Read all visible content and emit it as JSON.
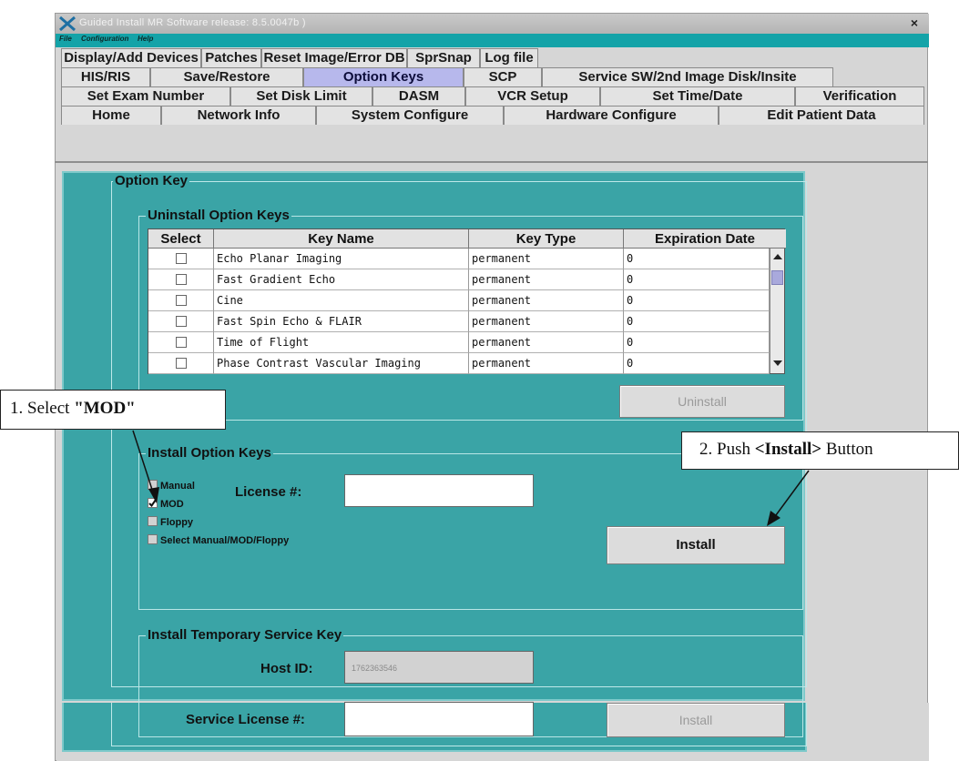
{
  "window": {
    "title": "Guided Install  MR Software release: 8.5.0047b )",
    "close_glyph": "×"
  },
  "menu": {
    "items": [
      "File",
      "Configuration",
      "Help"
    ]
  },
  "tabs": {
    "active": "Option Keys",
    "rows": [
      [
        "Display/Add Devices",
        "Patches",
        "Reset Image/Error DB",
        "SprSnap",
        "Log file"
      ],
      [
        "HIS/RIS",
        "Save/Restore",
        "Option Keys",
        "SCP",
        "Service SW/2nd Image Disk/Insite"
      ],
      [
        "Set Exam Number",
        "Set Disk Limit",
        "DASM",
        "VCR Setup",
        "Set Time/Date",
        "Verification"
      ],
      [
        "Home",
        "Network Info",
        "System Configure",
        "Hardware Configure",
        "Edit Patient Data"
      ]
    ]
  },
  "option_key": {
    "title": "Option Key",
    "uninstall": {
      "title": "Uninstall Option Keys",
      "columns": [
        "Select",
        "Key Name",
        "Key Type",
        "Expiration Date"
      ],
      "rows": [
        {
          "name": "Echo Planar Imaging",
          "type": "permanent",
          "expiration": "0"
        },
        {
          "name": "Fast Gradient Echo",
          "type": "permanent",
          "expiration": "0"
        },
        {
          "name": "Cine",
          "type": "permanent",
          "expiration": "0"
        },
        {
          "name": "Fast Spin Echo & FLAIR",
          "type": "permanent",
          "expiration": "0"
        },
        {
          "name": "Time of Flight",
          "type": "permanent",
          "expiration": "0"
        },
        {
          "name": "Phase Contrast Vascular Imaging",
          "type": "permanent",
          "expiration": "0"
        }
      ],
      "button": "Uninstall"
    },
    "install": {
      "title": "Install Option Keys",
      "options": [
        {
          "label": "Manual",
          "checked": false
        },
        {
          "label": "MOD",
          "checked": true
        },
        {
          "label": "Floppy",
          "checked": false
        },
        {
          "label": "Select Manual/MOD/Floppy",
          "checked": false
        }
      ],
      "license_label": "License #:",
      "license_value": "",
      "button": "Install"
    },
    "temp_service": {
      "title": "Install Temporary Service Key",
      "host_id_label": "Host ID:",
      "host_id_value": "1762363546",
      "service_license_label": "Service License #:",
      "service_license_value": "",
      "button": "Install"
    }
  },
  "annotations": {
    "step1_prefix": "1. Select ",
    "step1_bold": "\"MOD\"",
    "step2_prefix": "2. Push ",
    "step2_bold": "<Install>",
    "step2_suffix": " Button"
  },
  "colors": {
    "panel": "#3aa4a6",
    "menubar": "#14a3a8",
    "active_tab": "#b7b8ec",
    "window_bg": "#d6d6d6"
  }
}
